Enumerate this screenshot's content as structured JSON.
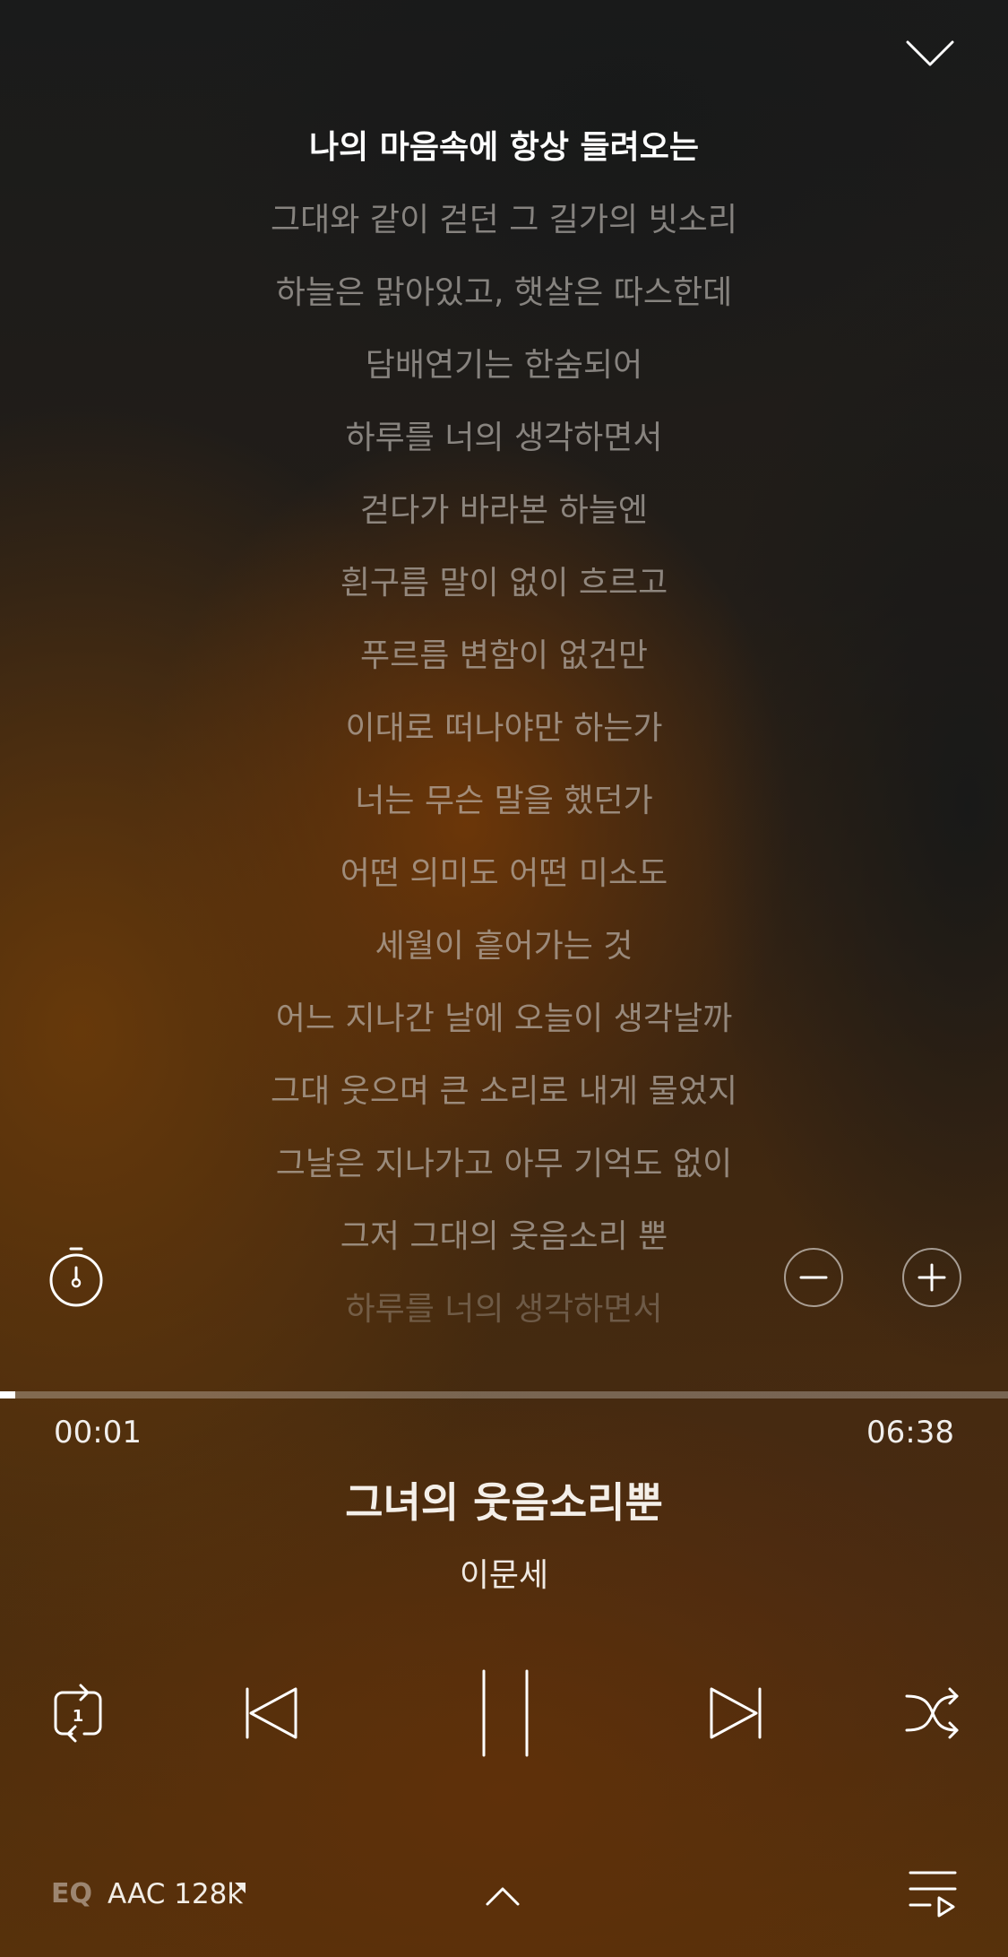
{
  "lyrics": {
    "lines": [
      "나의 마음속에 항상 들려오는",
      "그대와 같이 걷던 그 길가의 빗소리",
      "하늘은 맑아있고, 햇살은 따스한데",
      "담배연기는 한숨되어",
      "하루를 너의 생각하면서",
      "걷다가 바라본 하늘엔",
      "흰구름 말이 없이 흐르고",
      "푸르름 변함이 없건만",
      "이대로 떠나야만 하는가",
      "너는 무슨 말을 했던가",
      "어떤 의미도 어떤 미소도",
      "세월이 흩어가는 것",
      "어느 지나간 날에 오늘이 생각날까",
      "그대 웃으며 큰 소리로 내게 물었지",
      "그날은 지나가고 아무 기억도 없이",
      "그저 그대의 웃음소리 뿐",
      "하루를 너의 생각하면서"
    ],
    "current_index": 0
  },
  "player": {
    "elapsed": "00:01",
    "total": "06:38",
    "progress": 0.0025,
    "title": "그녀의 웃음소리뿐",
    "artist": "이문세"
  },
  "footer": {
    "eq_label": "EQ",
    "quality": "AAC 128k"
  },
  "controls": {
    "repeat_badge": "1"
  },
  "icons": {
    "collapse": "chevron-down-icon",
    "timer": "stopwatch-icon",
    "font_decrease": "minus-icon",
    "font_increase": "plus-icon",
    "repeat": "repeat-one-icon",
    "previous": "skip-previous-icon",
    "pause": "pause-icon",
    "next": "skip-next-icon",
    "shuffle": "shuffle-icon",
    "expand": "chevron-up-icon",
    "playlist": "playlist-icon"
  },
  "colors": {
    "accent": "#ffffff",
    "background_dark": "#1b1c1c",
    "background_warm": "#6e3708"
  }
}
